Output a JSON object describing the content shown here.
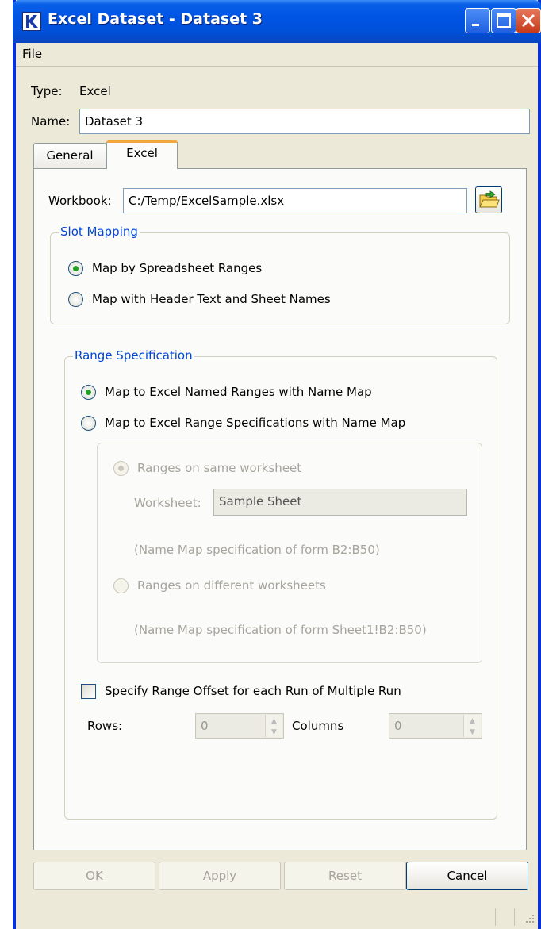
{
  "window": {
    "title": "Excel Dataset - Dataset 3"
  },
  "menu": {
    "file": "File"
  },
  "type": {
    "label": "Type:",
    "value": "Excel"
  },
  "name": {
    "label": "Name:",
    "value": "Dataset 3"
  },
  "tabs": [
    {
      "label": "General"
    },
    {
      "label": "Excel"
    }
  ],
  "workbook": {
    "label": "Workbook:",
    "value": "C:/Temp/ExcelSample.xlsx"
  },
  "slot_mapping": {
    "title": "Slot Mapping",
    "option1": "Map by Spreadsheet Ranges",
    "option2": "Map with Header Text and Sheet Names"
  },
  "range_spec": {
    "title": "Range Specification",
    "option1": "Map to Excel Named Ranges with Name Map",
    "option2": "Map to Excel Range Specifications with Name Map",
    "same_sheet": "Ranges on same worksheet",
    "worksheet_label": "Worksheet:",
    "worksheet_value": "Sample Sheet",
    "same_hint": "(Name Map specification of form B2:B50)",
    "diff_sheet": "Ranges on different worksheets",
    "diff_hint": "(Name Map specification of form Sheet1!B2:B50)"
  },
  "offset": {
    "label": "Specify Range Offset for each Run of Multiple Run",
    "rows_label": "Rows:",
    "rows_value": "0",
    "cols_label": "Columns",
    "cols_value": "0"
  },
  "buttons": {
    "ok": "OK",
    "apply": "Apply",
    "reset": "Reset",
    "cancel": "Cancel"
  }
}
